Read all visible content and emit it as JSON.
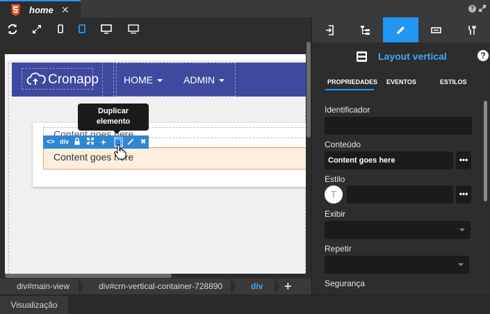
{
  "file_tab": {
    "title": "home",
    "close_glyph": "✕",
    "icon": "html5-icon"
  },
  "window": {
    "help_glyph": "?"
  },
  "toolbar": {
    "icons": [
      "refresh-icon",
      "expand-icon",
      "mobile-icon",
      "tablet-icon",
      "desktop-icon",
      "monitor-icon"
    ]
  },
  "canvas": {
    "brand": "Cronapp",
    "nav_items": [
      "HOME",
      "ADMIN"
    ],
    "content_top": "Content goes here",
    "content_selected": "Content goes here",
    "element_bar": {
      "tag_label": "div"
    },
    "tooltip": [
      "Duplicar",
      "elemento"
    ]
  },
  "breadcrumb": {
    "items": [
      "div#main-view",
      "div#crn-vertical-container-728890",
      "div"
    ],
    "add_glyph": "+"
  },
  "bottom": {
    "tab_label": "Visualização"
  },
  "panel": {
    "component_title": "Layout vertical",
    "help_glyph": "?",
    "subtabs": [
      "PROPRIEDADES",
      "EVENTOS",
      "ESTILOS"
    ],
    "fields": {
      "identificador_label": "Identificador",
      "identificador_value": "",
      "conteudo_label": "Conteúdo",
      "conteudo_value": "Content goes here",
      "estilo_label": "Estilo",
      "estilo_initial": "T",
      "exibir_label": "Exibir",
      "repetir_label": "Repetir",
      "seguranca_label": "Segurança"
    },
    "dots_glyph": "•••"
  },
  "colors": {
    "accent": "#2196f3",
    "navbar": "#3f4a9e",
    "selection": "#fdeedd"
  }
}
